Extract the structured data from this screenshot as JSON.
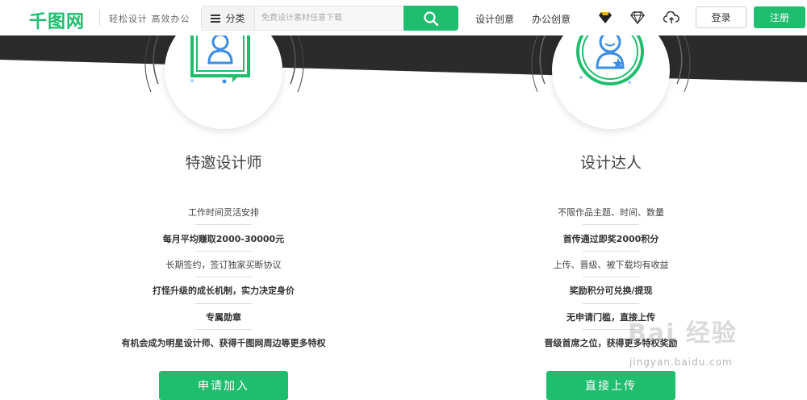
{
  "header": {
    "logo": "千图网",
    "slogan": "轻松设计 高效办公",
    "category_label": "分类",
    "search_placeholder": "免费设计素材任意下载",
    "nav": [
      "设计创意",
      "办公创意"
    ],
    "login_label": "登录",
    "register_label": "注册",
    "icons": [
      "vip-gem-icon",
      "diamond-icon",
      "upload-cloud-icon"
    ]
  },
  "cards": [
    {
      "title": "特邀设计师",
      "icon": "designer-badge-icon",
      "items": [
        {
          "text": "工作时间灵活安排",
          "bold": false
        },
        {
          "text": "每月平均赚取2000-30000元",
          "bold": true
        },
        {
          "text": "长期签约，签订独家买断协议",
          "bold": false
        },
        {
          "text": "打怪升级的成长机制，实力决定身价",
          "bold": true
        },
        {
          "text": "专属勋章",
          "bold": true
        },
        {
          "text": "有机会成为明星设计师、获得千图网周边等更多特权",
          "bold": true
        }
      ],
      "cta": "申请加入"
    },
    {
      "title": "设计达人",
      "icon": "expert-badge-icon",
      "items": [
        {
          "text": "不限作品主题、时间、数量",
          "bold": false
        },
        {
          "text": "首传通过即奖2000积分",
          "bold": true
        },
        {
          "text": "上传、晋级、被下载均有收益",
          "bold": false
        },
        {
          "text": "奖励积分可兑换/提现",
          "bold": true
        },
        {
          "text": "无申请门槛，直接上传",
          "bold": true
        },
        {
          "text": "晋级首席之位，获得更多特权奖励",
          "bold": true
        }
      ],
      "cta": "直接上传"
    }
  ],
  "watermark": {
    "brand": "Bai 经验",
    "url": "jingyan.baidu.com"
  },
  "colors": {
    "accent": "#1ebe6e",
    "banner_dark": "#2b2b2b",
    "icon_blue": "#3a8ee6"
  }
}
